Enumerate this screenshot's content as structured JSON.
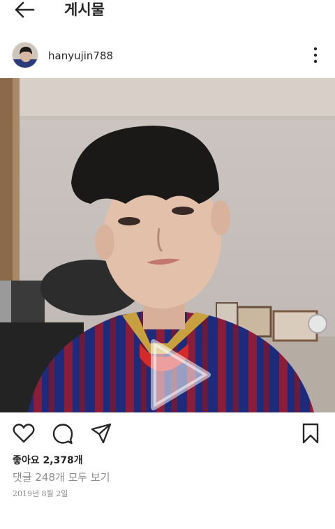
{
  "header": {
    "title": "게시물",
    "back_icon": "arrow-left-icon"
  },
  "post": {
    "username": "hanyujin788",
    "avatar_icon": "profile-avatar",
    "more_icon": "more-vertical-icon",
    "media": {
      "type": "video",
      "play_icon": "play-icon"
    },
    "actions": {
      "like_icon": "heart-icon",
      "comment_icon": "comment-bubble-icon",
      "share_icon": "send-paper-plane-icon",
      "save_icon": "bookmark-icon"
    },
    "likes_text": "좋아요 2,378개",
    "comments_text": "댓글 248개 모두 보기",
    "date": "2019년 8월 2일"
  },
  "colors": {
    "text": "#262626",
    "secondary": "#8e8e8e",
    "background": "#ffffff"
  }
}
